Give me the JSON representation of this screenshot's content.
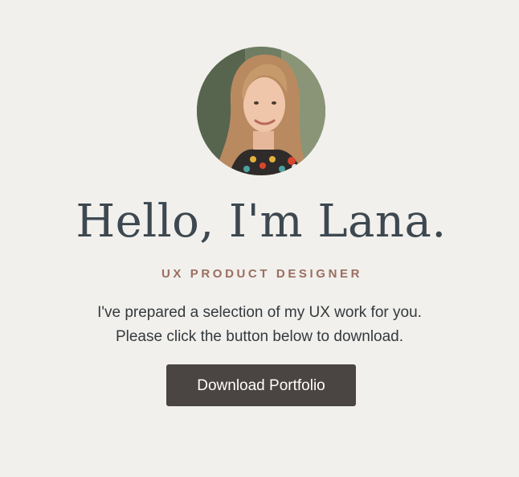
{
  "profile": {
    "avatar_icon": "profile-photo",
    "greeting": "Hello, I'm Lana.",
    "role": "UX PRODUCT DESIGNER",
    "intro_lines": [
      "I've prepared a selection of my UX work for you.",
      "Please click the button below to download."
    ]
  },
  "actions": {
    "download_label": "Download Portfolio"
  },
  "colors": {
    "background": "#f1f0ec",
    "heading": "#3d4850",
    "accent": "#9b6e60",
    "button": "#4a4442"
  }
}
